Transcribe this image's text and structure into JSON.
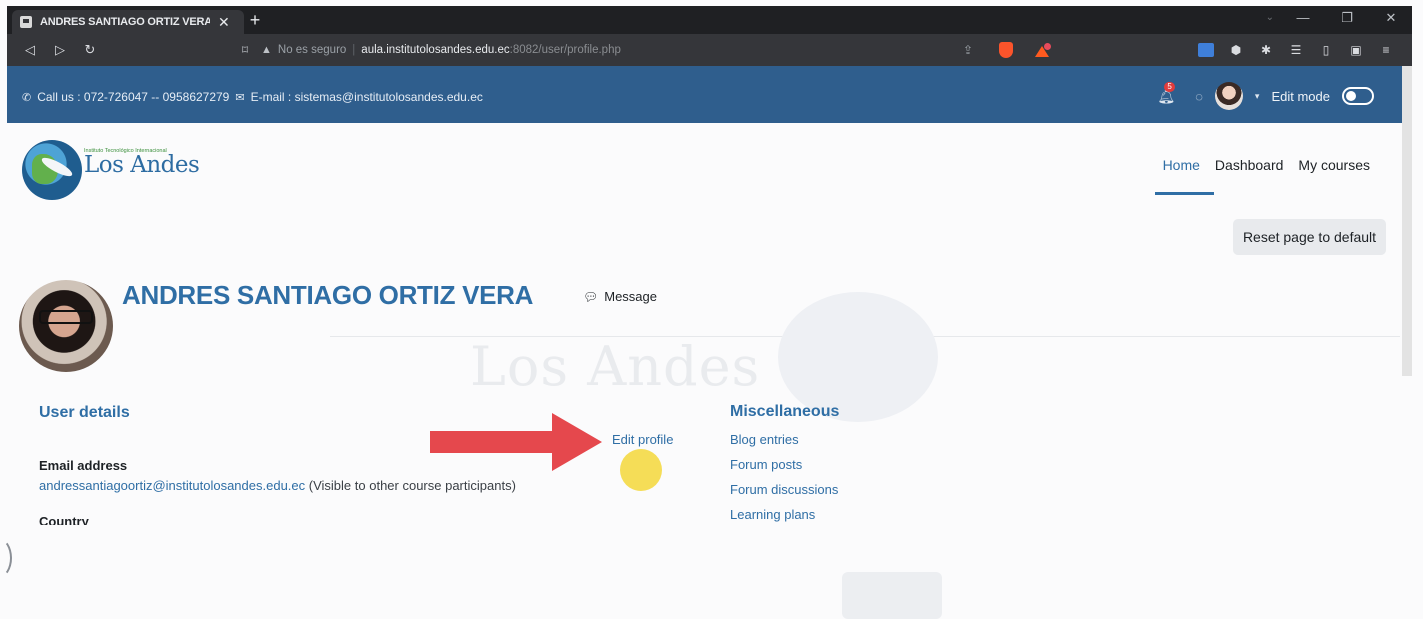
{
  "browser": {
    "tab_title": "ANDRES SANTIAGO ORTIZ VERA",
    "tab_close": "✕",
    "new_tab": "+",
    "not_secure": "No es seguro",
    "url_host": "aula.institutolosandes.edu.ec",
    "url_path": ":8082/user/profile.php"
  },
  "topbar": {
    "phone_text": "Call us : 072-726047 -- 0958627279",
    "email_text": "E-mail : sistemas@institutolosandes.edu.ec",
    "notification_count": "5",
    "edit_mode_label": "Edit mode"
  },
  "header": {
    "logo_small": "Instituto Tecnológico Internacional",
    "logo_name": "Los Andes",
    "nav": [
      "Home",
      "Dashboard",
      "My courses"
    ],
    "active_nav": "Home",
    "reset_button": "Reset page to default"
  },
  "watermark": {
    "text": "Los Andes"
  },
  "profile": {
    "name": "ANDRES SANTIAGO ORTIZ VERA",
    "message_label": "Message",
    "user_details_title": "User details",
    "edit_profile": "Edit profile",
    "email_label": "Email address",
    "email_value": "andressantiagoortiz@institutolosandes.edu.ec",
    "email_note": "(Visible to other course participants)",
    "country_label": "Country",
    "misc_title": "Miscellaneous",
    "misc_links": [
      "Blog entries",
      "Forum posts",
      "Forum discussions",
      "Learning plans"
    ]
  },
  "colors": {
    "topbar": "#2f5e8d",
    "link": "#2f6ea5",
    "arrow": "#e5484d",
    "cursor_highlight": "#f3d73a"
  }
}
